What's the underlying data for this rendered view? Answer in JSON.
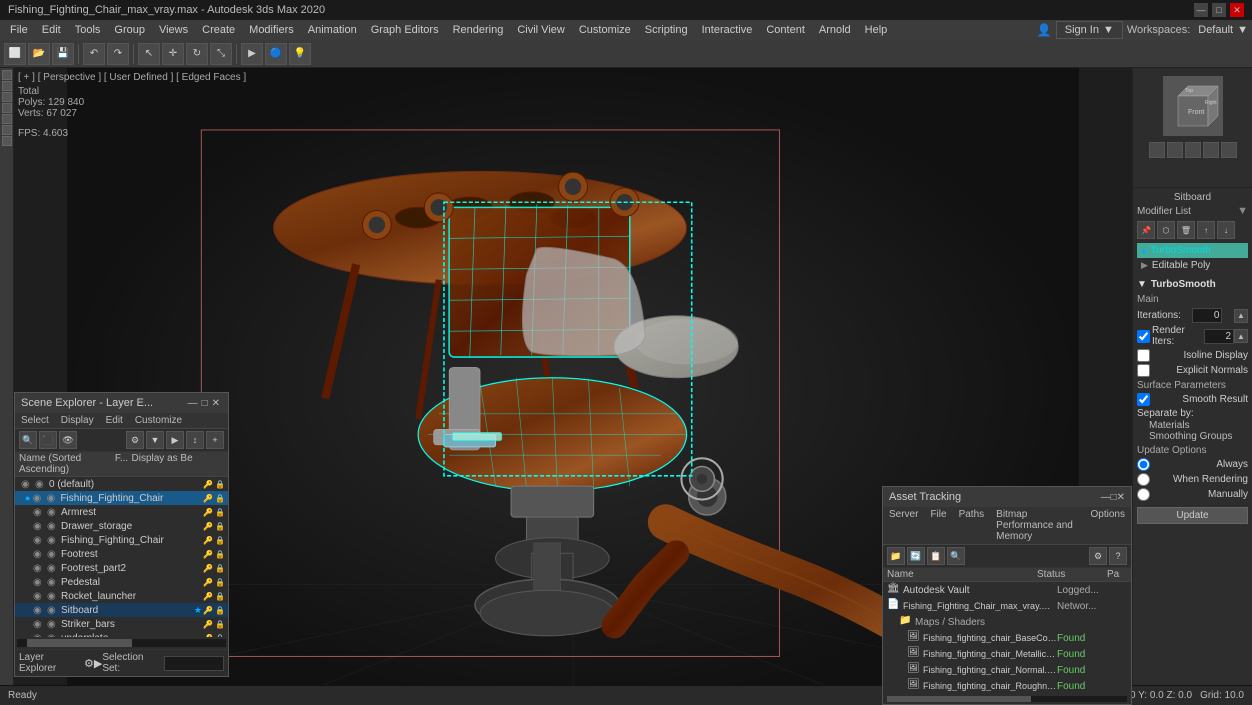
{
  "titlebar": {
    "title": "Fishing_Fighting_Chair_max_vray.max - Autodesk 3ds Max 2020",
    "minimize": "—",
    "maximize": "□",
    "close": "✕"
  },
  "menubar": {
    "items": [
      "File",
      "Edit",
      "Tools",
      "Group",
      "Views",
      "Create",
      "Modifiers",
      "Animation",
      "Graph Editors",
      "Rendering",
      "Civil View",
      "Customize",
      "Scripting",
      "Interactive",
      "Content",
      "Arnold",
      "Help"
    ]
  },
  "toolbar": {
    "sign_in": "Sign In",
    "workspaces": "Workspaces:",
    "workspaces_val": "Default"
  },
  "viewport": {
    "label": "[ + ] [ Perspective ] [ User Defined ] [ Edged Faces ]",
    "stats_label": "Total",
    "polys_label": "Polys:",
    "polys_val": "129 840",
    "verts_label": "Verts:",
    "verts_val": "67 027",
    "fps_label": "FPS:",
    "fps_val": "4.603"
  },
  "right_panel": {
    "modifier_list_title": "Modifier List",
    "modifiers": [
      {
        "name": "TurboSmooth",
        "active": true,
        "expanded": true
      },
      {
        "name": "Editable Poly",
        "active": false,
        "expanded": false
      }
    ],
    "sitboard_label": "Sitboard",
    "turbosmooth": {
      "title": "TurboSmooth",
      "main_label": "Main",
      "iterations_label": "Iterations:",
      "iterations_val": "0",
      "render_iters_label": "Render Iters:",
      "render_iters_val": "2",
      "isoline_display": "Isoline Display",
      "explicit_normals": "Explicit Normals",
      "surface_params": "Surface Parameters",
      "smooth_result": "Smooth Result",
      "separate_by": "Separate by:",
      "materials": "Materials",
      "smoothing_groups": "Smoothing Groups",
      "update_options": "Update Options",
      "always": "Always",
      "when_rendering": "When Rendering",
      "manually": "Manually",
      "update_btn": "Update"
    }
  },
  "scene_explorer": {
    "title": "Scene Explorer - Layer E...",
    "menu_items": [
      "Select",
      "Display",
      "Edit",
      "Customize"
    ],
    "table_headers": {
      "name": "Name (Sorted Ascending)",
      "f": "F...",
      "display": "Display as Be"
    },
    "items": [
      {
        "level": 0,
        "name": "0 (default)",
        "type": "layer",
        "visible": true
      },
      {
        "level": 1,
        "name": "Fishing_Fighting_Chair",
        "type": "group",
        "visible": true,
        "selected": true
      },
      {
        "level": 2,
        "name": "Armrest",
        "type": "mesh",
        "visible": true
      },
      {
        "level": 2,
        "name": "Drawer_storage",
        "type": "mesh",
        "visible": true
      },
      {
        "level": 2,
        "name": "Fishing_Fighting_Chair",
        "type": "mesh",
        "visible": true
      },
      {
        "level": 2,
        "name": "Footrest",
        "type": "mesh",
        "visible": true
      },
      {
        "level": 2,
        "name": "Footrest_part2",
        "type": "mesh",
        "visible": true
      },
      {
        "level": 2,
        "name": "Pedestal",
        "type": "mesh",
        "visible": true
      },
      {
        "level": 2,
        "name": "Rocket_launcher",
        "type": "mesh",
        "visible": true
      },
      {
        "level": 2,
        "name": "Sitboard",
        "type": "mesh",
        "visible": true,
        "active": true
      },
      {
        "level": 2,
        "name": "Striker_bars",
        "type": "mesh",
        "visible": true
      },
      {
        "level": 2,
        "name": "underplate",
        "type": "mesh",
        "visible": true
      }
    ],
    "footer": {
      "layer_explorer": "Layer Explorer",
      "selection_set": "Selection Set:"
    }
  },
  "asset_tracking": {
    "title": "Asset Tracking",
    "menu_items": [
      "Server",
      "File",
      "Paths",
      "Bitmap Performance and Memory",
      "Options"
    ],
    "table_headers": {
      "name": "Name",
      "status": "Status",
      "path": "Pa"
    },
    "items": [
      {
        "level": 0,
        "name": "Autodesk Vault",
        "type": "vault",
        "status": "Logged...",
        "path": ""
      },
      {
        "level": 0,
        "name": "Fishing_Fighting_Chair_max_vray.max",
        "type": "file",
        "status": "Networ...",
        "path": ""
      },
      {
        "level": 1,
        "name": "Maps / Shaders",
        "type": "folder",
        "status": "",
        "path": ""
      },
      {
        "level": 2,
        "name": "Fishing_fighting_chair_BaseColor.png",
        "type": "image",
        "status": "Found",
        "path": ""
      },
      {
        "level": 2,
        "name": "Fishing_fighting_chair_Metallic.png",
        "type": "image",
        "status": "Found",
        "path": ""
      },
      {
        "level": 2,
        "name": "Fishing_fighting_chair_Normal.png",
        "type": "image",
        "status": "Found",
        "path": ""
      },
      {
        "level": 2,
        "name": "Fishing_fighting_chair_Roughness.png",
        "type": "image",
        "status": "Found",
        "path": ""
      }
    ]
  }
}
